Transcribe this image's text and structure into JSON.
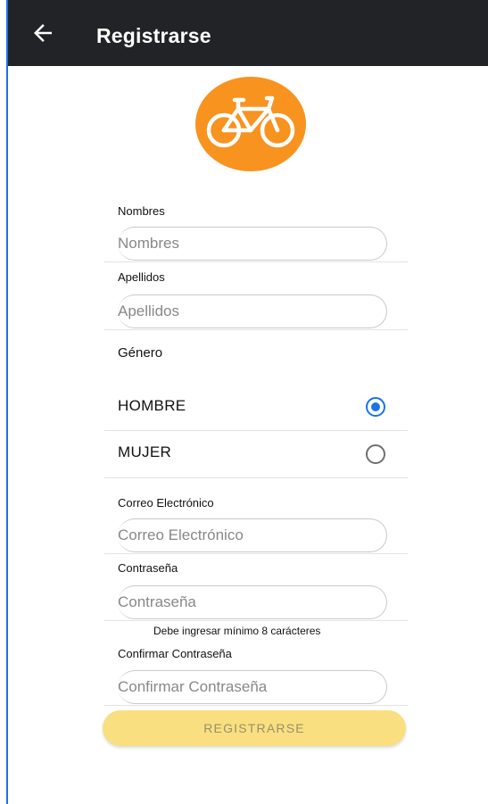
{
  "appbar": {
    "title": "Registrarse",
    "back_icon": "arrow-left-icon"
  },
  "logo": {
    "icon": "bicycle-icon",
    "color": "#f7931e"
  },
  "fields": {
    "nombres": {
      "label": "Nombres",
      "placeholder": "Nombres",
      "value": ""
    },
    "apellidos": {
      "label": "Apellidos",
      "placeholder": "Apellidos",
      "value": ""
    },
    "correo": {
      "label": "Correo Electrónico",
      "placeholder": "Correo Electrónico",
      "value": ""
    },
    "contrasena": {
      "label": "Contraseña",
      "placeholder": "Contraseña",
      "value": "",
      "hint": "Debe ingresar mínimo 8 carácteres"
    },
    "confirmar": {
      "label": "Confirmar Contraseña",
      "placeholder": "Confirmar Contraseña",
      "value": ""
    }
  },
  "genero": {
    "label": "Género",
    "options": [
      {
        "label": "HOMBRE",
        "selected": true
      },
      {
        "label": "MUJER",
        "selected": false
      }
    ]
  },
  "submit": {
    "label": "REGISTRARSE"
  },
  "colors": {
    "appbar": "#222326",
    "accent": "#1a73e8",
    "button": "#f9df7f"
  }
}
